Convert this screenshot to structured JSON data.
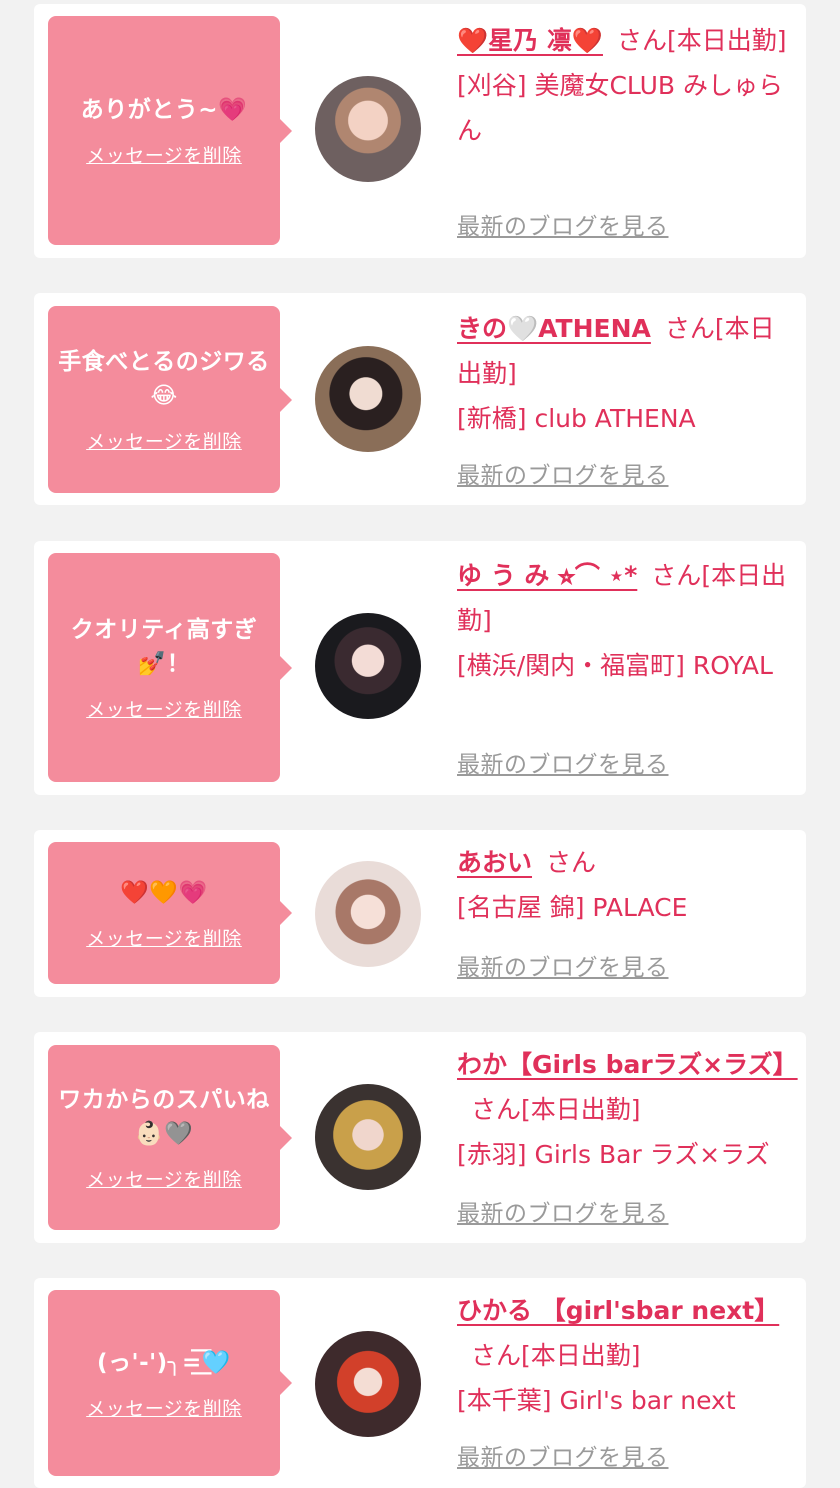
{
  "delete_label": "メッセージを削除",
  "blog_label": "最新のブログを見る",
  "san_suffix": "さん",
  "cards": [
    {
      "message": "ありがとう~💗",
      "name": "❤️星乃 凛❤️",
      "status": "[本日出勤]",
      "shop": "[刈谷] 美魔女CLUB みしゅらん"
    },
    {
      "message": "手食べとるのジワる😂",
      "name": "きの🤍ATHENA",
      "status": "[本日出勤]",
      "shop": "[新橋] club ATHENA"
    },
    {
      "message": "クオリティ高すぎ💅！",
      "name": "ゆ う み ⭐︎⌒ ⋆*",
      "status": "[本日出勤]",
      "shop": "[横浜/関内・福富町] ROYAL"
    },
    {
      "message": "❤️🧡💗",
      "name": "あおい",
      "status": "",
      "shop": "[名古屋 錦] PALACE"
    },
    {
      "message": "ワカからのスパいね👶🏻🩶",
      "name": "わか【Girls barラズ×ラズ】",
      "status": "[本日出勤]",
      "shop": "[赤羽] Girls Bar ラズ×ラズ"
    },
    {
      "message": "(っ'-')╮=͟͟͞͞🩵",
      "name": "ひかる 【girl'sbar next】",
      "status": "[本日出勤]",
      "shop": "[本千葉] Girl's bar next"
    }
  ],
  "colors": {
    "accent": "#e0305a",
    "bubble": "#f48c9c",
    "background": "#f2f2f2",
    "link_gray": "#9a9a9a"
  }
}
